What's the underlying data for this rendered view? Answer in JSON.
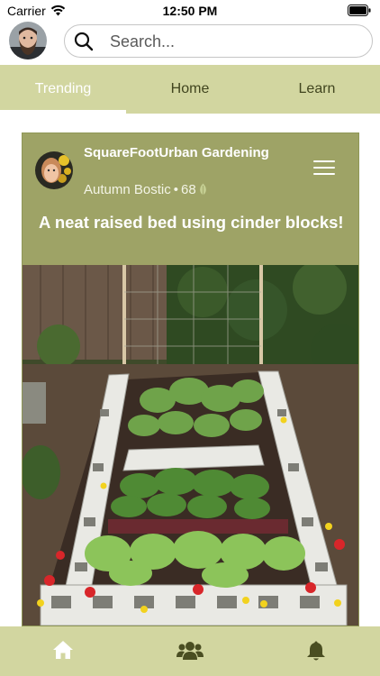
{
  "status_bar": {
    "carrier": "Carrier",
    "time": "12:50 PM"
  },
  "search": {
    "placeholder": "Search..."
  },
  "tabs": [
    {
      "label": "Trending",
      "active": true
    },
    {
      "label": "Home",
      "active": false
    },
    {
      "label": "Learn",
      "active": false
    }
  ],
  "post": {
    "group_name": "SquareFootUrban Gardening",
    "author": "Autumn Bostic",
    "separator": "•",
    "points": "68",
    "title": "A neat raised bed using cinder blocks!"
  },
  "bottom_nav": [
    {
      "icon": "home-icon"
    },
    {
      "icon": "users-group-icon"
    },
    {
      "icon": "bell-icon"
    }
  ],
  "colors": {
    "accent_bar": "#d2d6a0",
    "card_header": "#9ea366",
    "nav_icon": "#4a4e22"
  }
}
